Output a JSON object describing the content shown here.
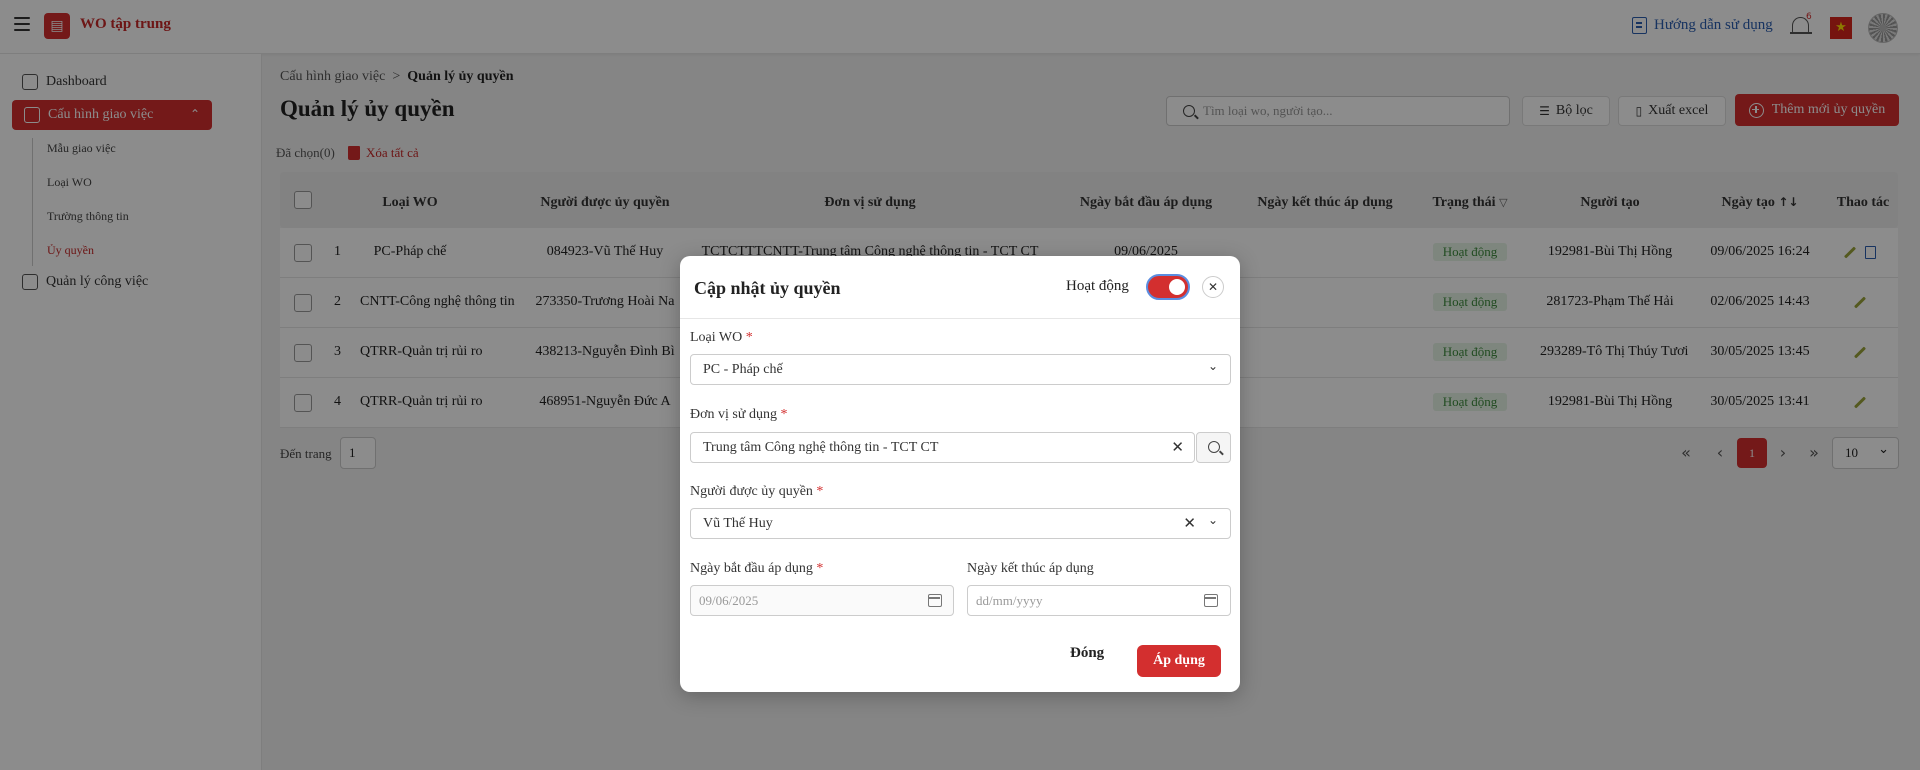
{
  "header": {
    "app_title": "WO tập trung",
    "logo_text": "▤",
    "guide_label": "Hướng dẫn sử dụng",
    "notification_count": "6",
    "flag_star": "★"
  },
  "sidebar": {
    "dashboard": "Dashboard",
    "config": "Cấu hình giao việc",
    "config_chevron": "⌃",
    "sub_items": [
      "Mẫu giao việc",
      "Loại WO",
      "Trường thông tin",
      "Ủy quyền"
    ],
    "task_mgmt": "Quản lý công việc"
  },
  "main": {
    "breadcrumb_parent": "Cấu hình giao việc",
    "breadcrumb_sep": ">",
    "breadcrumb_current": "Quản lý ủy quyền",
    "title": "Quản lý ủy quyền",
    "search_placeholder": "Tìm loại wo, người tạo...",
    "filter_label": "Bộ lọc",
    "export_label": "Xuất excel",
    "add_label": "Thêm mới ủy quyền",
    "selected_label": "Đã chọn(0)",
    "delete_all_label": "Xóa tất cả"
  },
  "table": {
    "headers": [
      "Loại WO",
      "Người được ủy quyền",
      "Đơn vị sử dụng",
      "Ngày bắt đầu áp dụng",
      "Ngày kết thúc áp dụng",
      "Trạng thái",
      "Người tạo",
      "Ngày tạo",
      "Thao tác"
    ],
    "status_filter_icon": "▽",
    "sort_icon": "↑↓",
    "rows": [
      {
        "no": "1",
        "wo_type": "PC-Pháp chế",
        "delegate": "084923-Vũ Thế Huy",
        "unit": "TCTCTTTCNTT-Trung tâm Công nghệ thông tin - TCT CT",
        "start": "09/06/2025",
        "end": "",
        "status": "Hoạt động",
        "creator": "192981-Bùi Thị Hồng",
        "created": "09/06/2025 16:24"
      },
      {
        "no": "2",
        "wo_type": "CNTT-Công nghệ thông tin",
        "delegate": "273350-Trương Hoài Na",
        "unit": "",
        "start": "",
        "end": "",
        "status": "Hoạt động",
        "creator": "281723-Phạm Thế Hải",
        "created": "02/06/2025 14:43"
      },
      {
        "no": "3",
        "wo_type": "QTRR-Quản trị rủi ro",
        "delegate": "438213-Nguyễn Đình Bì",
        "unit": "",
        "start": "",
        "end": "",
        "status": "Hoạt động",
        "creator": "293289-Tô Thị Thúy Tươi",
        "created": "30/05/2025 13:45"
      },
      {
        "no": "4",
        "wo_type": "QTRR-Quản trị rủi ro",
        "delegate": "468951-Nguyễn Đức A",
        "unit": "",
        "start": "",
        "end": "",
        "status": "Hoạt động",
        "creator": "192981-Bùi Thị Hồng",
        "created": "30/05/2025 13:41"
      }
    ]
  },
  "pagination": {
    "goto_label": "Đến trang",
    "goto_value": "1",
    "first": "«",
    "prev": "‹",
    "current": "1",
    "next": "›",
    "last": "»",
    "page_size": "10",
    "page_size_chevron": "⌄"
  },
  "modal": {
    "title": "Cập nhật ủy quyền",
    "status_label": "Hoạt động",
    "status_on": true,
    "close_icon": "✕",
    "wo_type_label": "Loại WO",
    "wo_type_value": "PC - Pháp chế",
    "unit_label": "Đơn vị sử dụng",
    "unit_value": "Trung tâm Công nghệ thông tin - TCT CT",
    "delegate_label": "Người được ủy quyền",
    "delegate_value": "Vũ Thế Huy",
    "start_label": "Ngày bắt đầu áp dụng",
    "start_value": "09/06/2025",
    "end_label": "Ngày kết thúc áp dụng",
    "end_placeholder": "dd/mm/yyyy",
    "required_mark": "*",
    "chevron": "⌄",
    "clear": "✕",
    "close_button": "Đóng",
    "apply_button": "Áp dụng"
  },
  "colors": {
    "primary": "#d32f2f",
    "status_bg": "#e6f4e6",
    "status_text": "#3c8a3c",
    "link": "#2a5db0"
  }
}
